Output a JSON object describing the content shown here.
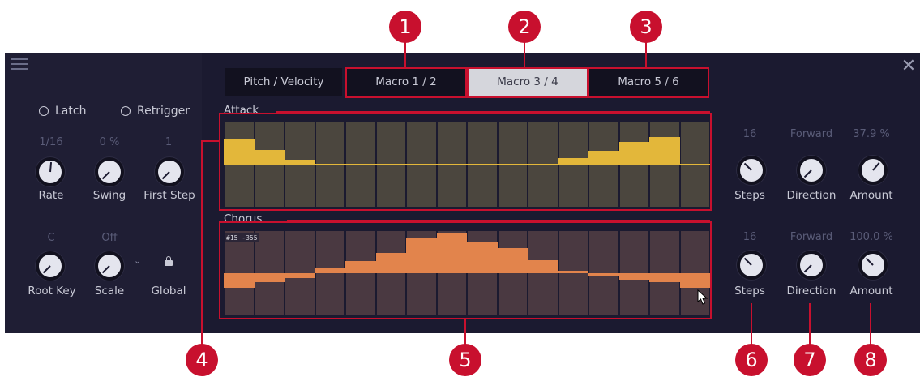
{
  "left_panel": {
    "latch_label": "Latch",
    "retrigger_label": "Retrigger",
    "rate": {
      "value": "1/16",
      "label": "Rate"
    },
    "swing": {
      "value": "0 %",
      "label": "Swing"
    },
    "first_step": {
      "value": "1",
      "label": "First Step"
    },
    "root_key": {
      "value": "C",
      "label": "Root Key"
    },
    "scale": {
      "value": "Off",
      "label": "Scale"
    },
    "global_label": "Global"
  },
  "tabs": [
    {
      "label": "Pitch / Velocity",
      "active": false
    },
    {
      "label": "Macro 1 / 2",
      "active": false
    },
    {
      "label": "Macro 3 / 4",
      "active": true
    },
    {
      "label": "Macro 5 / 6",
      "active": false
    }
  ],
  "attack": {
    "label": "Attack",
    "steps": {
      "value": "16",
      "label": "Steps"
    },
    "direction": {
      "value": "Forward",
      "label": "Direction"
    },
    "amount": {
      "value": "37.9 %",
      "label": "Amount"
    },
    "color": "#e3b73a",
    "bg_color": "#4b463e",
    "step_values": [
      0.62,
      0.35,
      0.12,
      0,
      0,
      0,
      0,
      0,
      0,
      0,
      0,
      0.16,
      0.33,
      0.54,
      0.66,
      0
    ]
  },
  "chorus": {
    "label": "Chorus",
    "tooltip": "#15 -355",
    "steps": {
      "value": "16",
      "label": "Steps"
    },
    "direction": {
      "value": "Forward",
      "label": "Direction"
    },
    "amount": {
      "value": "100.0 %",
      "label": "Amount"
    },
    "color": "#e2844c",
    "bg_color": "#4a3941",
    "step_values": [
      -0.35,
      -0.22,
      -0.12,
      0.12,
      0.28,
      0.48,
      0.82,
      0.95,
      0.75,
      0.6,
      0.3,
      0.06,
      -0.06,
      -0.15,
      -0.22,
      -0.35
    ]
  },
  "callouts": [
    "1",
    "2",
    "3",
    "4",
    "5",
    "6",
    "7",
    "8"
  ],
  "colors": {
    "accent_red": "#c8102e",
    "panel_bg": "#1b1a30",
    "text": "#c9cad6",
    "muted": "#5a5c78"
  }
}
